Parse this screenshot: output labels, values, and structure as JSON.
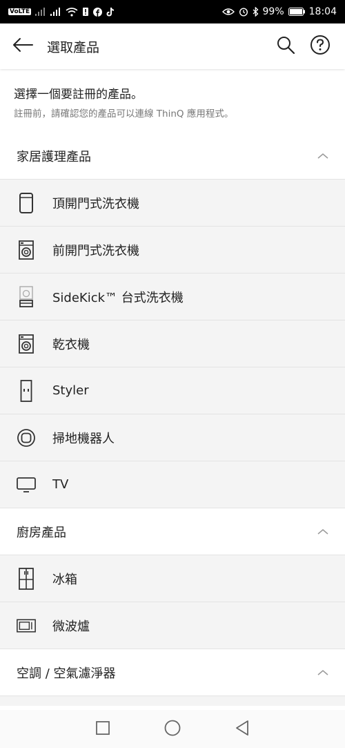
{
  "status_bar": {
    "volte": "VoLTE",
    "battery": "99%",
    "time": "18:04"
  },
  "header": {
    "title": "選取產品",
    "back_icon": "arrow-left-icon",
    "search_icon": "search-icon",
    "help_icon": "help-circle-icon"
  },
  "intro": {
    "title": "選擇一個要註冊的產品。",
    "subtitle": "註冊前，請確認您的產品可以連線 ThinQ 應用程式。"
  },
  "categories": [
    {
      "label": "家居護理產品",
      "items": [
        {
          "label": "頂開門式洗衣機",
          "icon": "top-load-washer-icon"
        },
        {
          "label": "前開門式洗衣機",
          "icon": "front-load-washer-icon"
        },
        {
          "label": "SideKick™ 台式洗衣機",
          "icon": "pedestal-washer-icon"
        },
        {
          "label": "乾衣機",
          "icon": "dryer-icon"
        },
        {
          "label": "Styler",
          "icon": "styler-icon"
        },
        {
          "label": "掃地機器人",
          "icon": "robot-vacuum-icon"
        },
        {
          "label": "TV",
          "icon": "tv-icon"
        }
      ]
    },
    {
      "label": "廚房產品",
      "items": [
        {
          "label": "冰箱",
          "icon": "refrigerator-icon"
        },
        {
          "label": "微波爐",
          "icon": "microwave-icon"
        }
      ]
    },
    {
      "label": "空調 / 空氣濾淨器",
      "items": []
    }
  ]
}
